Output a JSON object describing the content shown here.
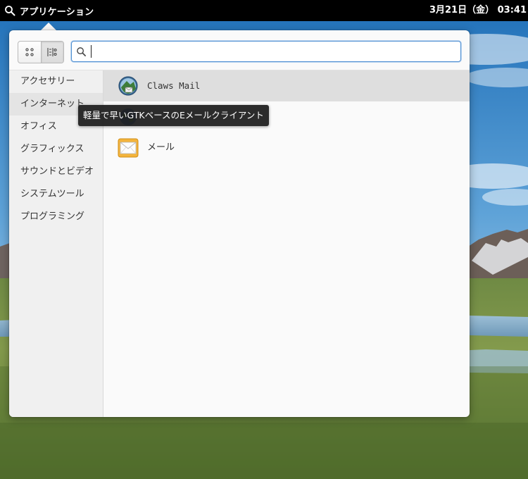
{
  "panel": {
    "applications_label": "アプリケーション",
    "clock": "3月21日（金）  03:41"
  },
  "launcher": {
    "search": {
      "value": "",
      "placeholder": ""
    },
    "view_modes": [
      "grid-view-icon",
      "category-view-icon"
    ],
    "active_view": "category-view-icon",
    "categories": [
      {
        "label": "アクセサリー"
      },
      {
        "label": "インターネット"
      },
      {
        "label": "オフィス"
      },
      {
        "label": "グラフィックス"
      },
      {
        "label": "サウンドとビデオ"
      },
      {
        "label": "システムツール"
      },
      {
        "label": "プログラミング"
      }
    ],
    "selected_category": "インターネット",
    "apps": [
      {
        "name": "Claws Mail",
        "icon": "claws-mail-icon"
      },
      {
        "name": "",
        "icon": "web-browser-icon"
      },
      {
        "name": "メール",
        "icon": "mail-icon"
      }
    ],
    "tooltip": "軽量で早いGTKベースのEメールクライアント"
  },
  "colors": {
    "panel": "#000000",
    "popover": "#fafafa",
    "sidebar": "#f0f0f0",
    "hover_row": "#dedede",
    "search_focus": "#4f8fd2"
  }
}
